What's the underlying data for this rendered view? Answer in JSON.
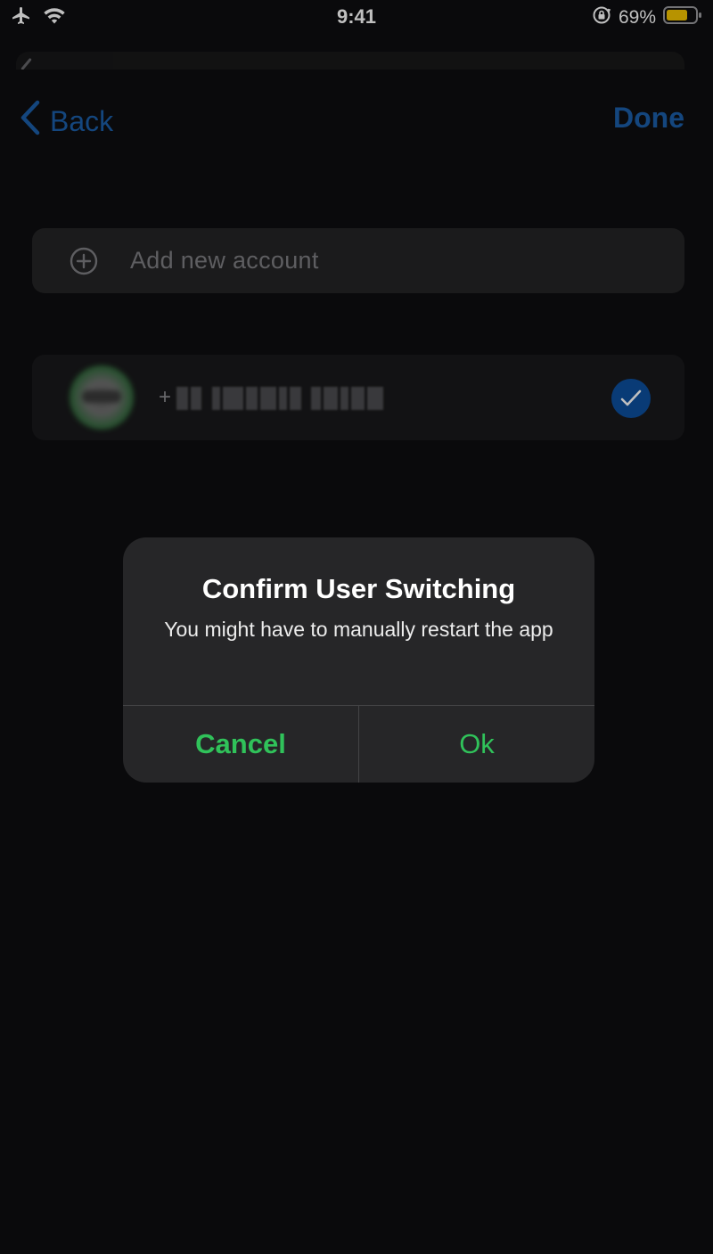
{
  "status_bar": {
    "time": "9:41",
    "battery_percent": "69%",
    "icons": [
      "airplane-icon",
      "wifi-icon",
      "orientation-lock-icon",
      "battery-icon"
    ],
    "battery_color": "#f5c400"
  },
  "nav": {
    "back_label": "Back",
    "done_label": "Done",
    "accent_color": "#1b5ea8"
  },
  "add_account": {
    "label": "Add new account",
    "icon": "plus-circle-icon"
  },
  "account": {
    "phone_prefix": "+",
    "selected": true,
    "check_icon": "checkmark-circle-icon"
  },
  "alert": {
    "title": "Confirm User Switching",
    "message": "You might have to manually restart the app",
    "cancel_label": "Cancel",
    "ok_label": "Ok",
    "button_color": "#30c25a"
  }
}
